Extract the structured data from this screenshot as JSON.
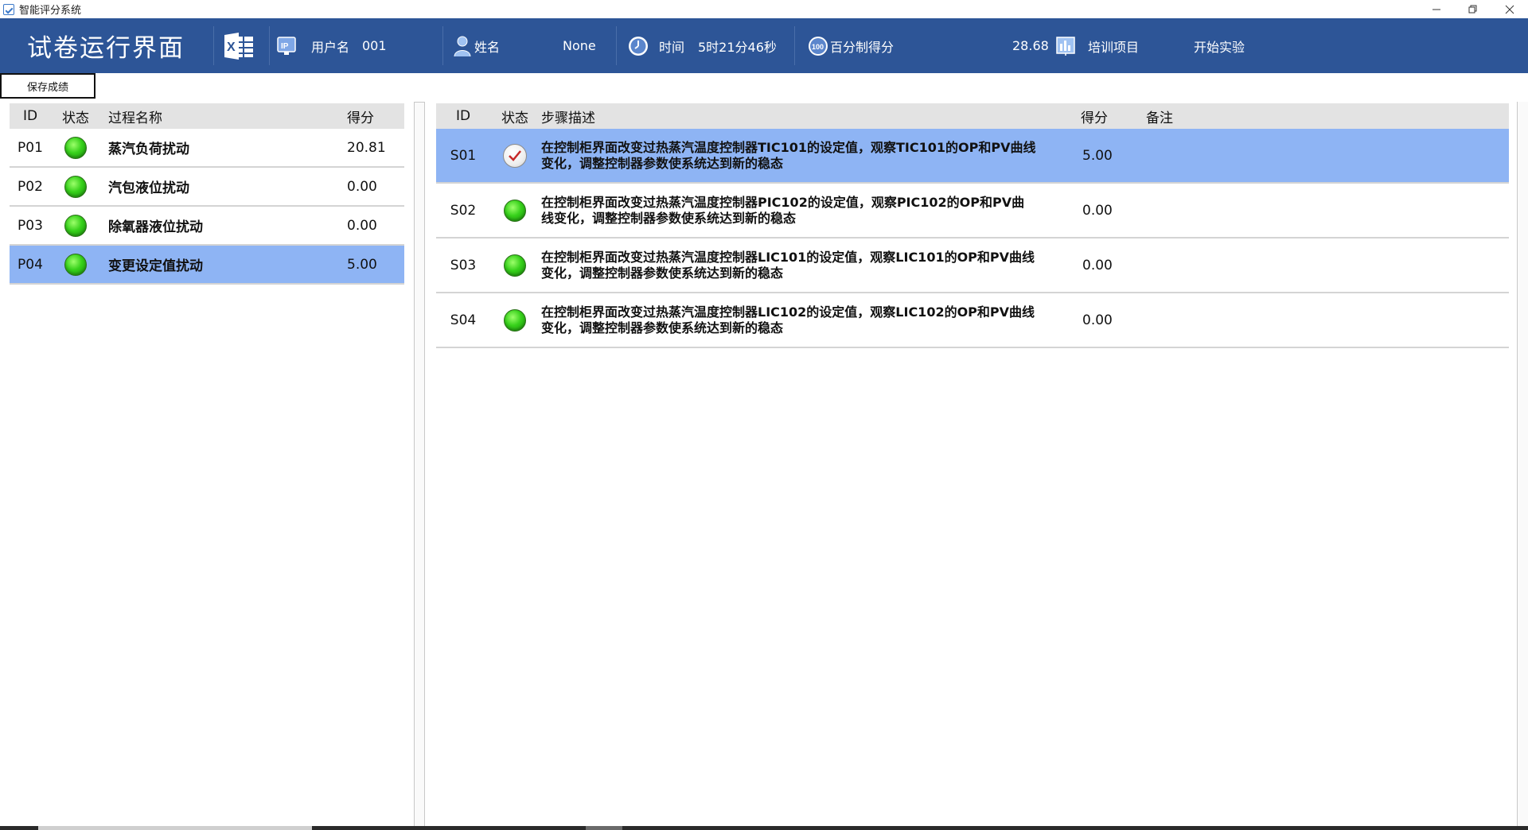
{
  "window": {
    "title": "智能评分系统",
    "icon": "app-check-icon"
  },
  "header": {
    "page_title": "试卷运行界面",
    "excel_icon": "excel-export-icon",
    "ip_icon": "ip-icon",
    "username_label": "用户名",
    "username_value": "001",
    "name_icon": "user-icon",
    "name_label": "姓名",
    "name_value": "None",
    "time_icon": "clock-icon",
    "time_label": "时间",
    "time_value": "5时21分46秒",
    "score_icon": "score-100-icon",
    "score_label": "百分制得分",
    "score_value": "28.68",
    "project_icon": "bar-chart-icon",
    "project_label": "培训项目",
    "project_value": "开始实验",
    "accent_color": "#2d5597"
  },
  "toolbar": {
    "save_label": "保存成绩"
  },
  "process_table": {
    "headers": {
      "id": "ID",
      "status": "状态",
      "name": "过程名称",
      "score": "得分"
    },
    "rows": [
      {
        "id": "P01",
        "status": "green",
        "name": "蒸汽负荷扰动",
        "score": "20.81",
        "selected": false
      },
      {
        "id": "P02",
        "status": "green",
        "name": "汽包液位扰动",
        "score": "0.00",
        "selected": false
      },
      {
        "id": "P03",
        "status": "green",
        "name": "除氧器液位扰动",
        "score": "0.00",
        "selected": false
      },
      {
        "id": "P04",
        "status": "green",
        "name": "变更设定值扰动",
        "score": "5.00",
        "selected": true
      }
    ]
  },
  "step_table": {
    "headers": {
      "id": "ID",
      "status": "状态",
      "desc": "步骤描述",
      "score": "得分",
      "note": "备注"
    },
    "rows": [
      {
        "id": "S01",
        "status": "check",
        "desc_line1": "在控制柜界面改变过热蒸汽温度控制器TIC101的设定值，观察TIC101的OP和PV曲线",
        "desc_line2": "变化，调整控制器参数使系统达到新的稳态",
        "score": "5.00",
        "note": "",
        "selected": true
      },
      {
        "id": "S02",
        "status": "green",
        "desc_line1": "在控制柜界面改变过热蒸汽温度控制器PIC102的设定值，观察PIC102的OP和PV曲",
        "desc_line2": "线变化，调整控制器参数使系统达到新的稳态",
        "score": "0.00",
        "note": "",
        "selected": false
      },
      {
        "id": "S03",
        "status": "green",
        "desc_line1": "在控制柜界面改变过热蒸汽温度控制器LIC101的设定值，观察LIC101的OP和PV曲线",
        "desc_line2": "变化，调整控制器参数使系统达到新的稳态",
        "score": "0.00",
        "note": "",
        "selected": false
      },
      {
        "id": "S04",
        "status": "green",
        "desc_line1": "在控制柜界面改变过热蒸汽温度控制器LIC102的设定值，观察LIC102的OP和PV曲线",
        "desc_line2": "变化，调整控制器参数使系统达到新的稳态",
        "score": "0.00",
        "note": "",
        "selected": false
      }
    ]
  },
  "colors": {
    "header_bg": "#2d5597",
    "selected_row": "#8eb4f4",
    "status_green": "#37d11b"
  }
}
